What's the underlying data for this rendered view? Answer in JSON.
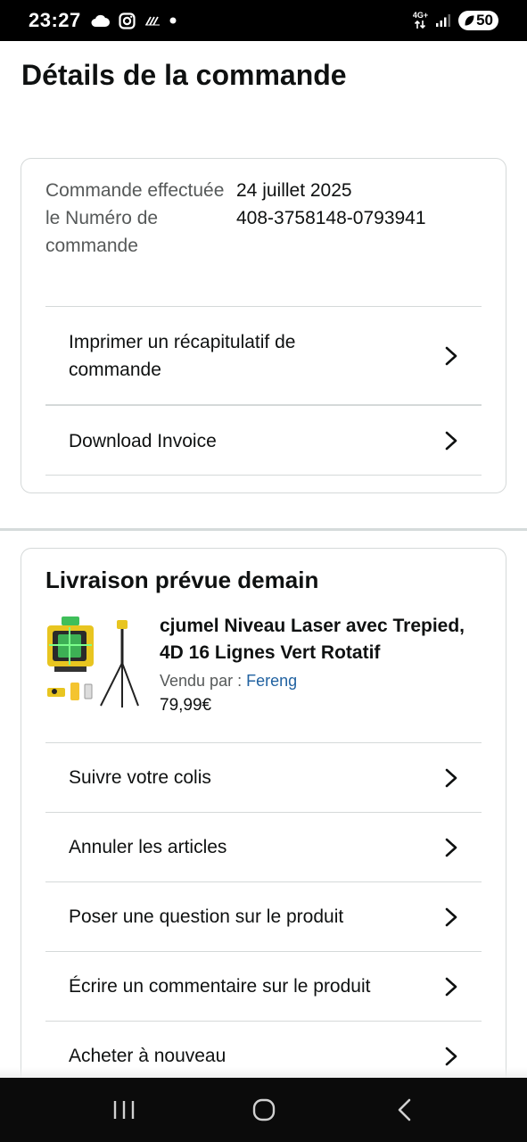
{
  "status_bar": {
    "time": "23:27",
    "network": "4G+",
    "battery": "50",
    "icons": [
      "cloud-icon",
      "instagram-icon",
      "signal-stripe-icon",
      "dot-icon",
      "data-arrows-icon",
      "signal-bars-icon",
      "battery-icon"
    ]
  },
  "page": {
    "title": "Détails de la commande"
  },
  "order_info": {
    "labels": "Commande effectuée le Numéro de commande",
    "date": "24 juillet 2025",
    "number": "408-3758148-0793941"
  },
  "order_actions": {
    "print": "Imprimer un récapitulatif de commande",
    "invoice": "Download Invoice"
  },
  "delivery": {
    "title": "Livraison prévue demain",
    "product": {
      "title": "cjumel Niveau Laser avec Trepied, 4D 16 Lignes Vert Rotatif",
      "sold_by_label": "Vendu par",
      "sold_by_separator": " : ",
      "seller": "Fereng",
      "price": "79,99€"
    },
    "actions": {
      "track": "Suivre votre colis",
      "cancel": "Annuler les articles",
      "question": "Poser une question sur le produit",
      "review": "Écrire un commentaire sur le produit",
      "buy_again": "Acheter à nouveau"
    }
  },
  "colors": {
    "link": "#2162a1",
    "border": "#d5d9d9",
    "text": "#0f1111",
    "muted": "#565959"
  }
}
